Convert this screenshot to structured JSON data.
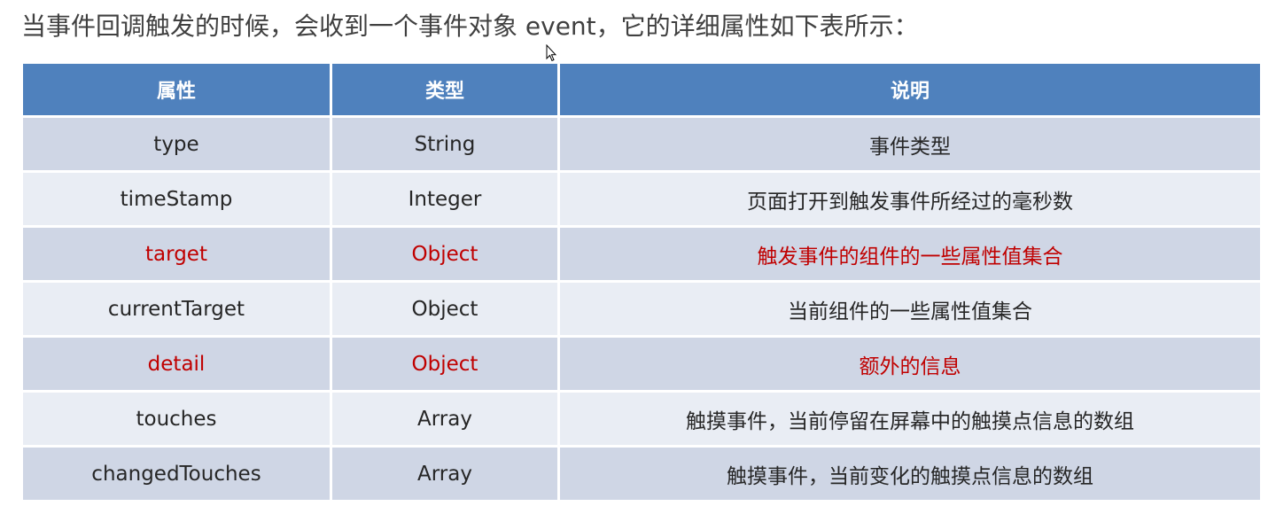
{
  "intro": "当事件回调触发的时候，会收到一个事件对象 event，它的详细属性如下表所示：",
  "colors": {
    "header_bg": "#4f81bd",
    "row_dark": "#cfd6e5",
    "row_light": "#e9edf4",
    "highlight_text": "#c00000"
  },
  "table": {
    "headers": [
      "属性",
      "类型",
      "说明"
    ],
    "rows": [
      {
        "property": "type",
        "type": "String",
        "description": "事件类型",
        "highlighted": false
      },
      {
        "property": "timeStamp",
        "type": "Integer",
        "description": "页面打开到触发事件所经过的毫秒数",
        "highlighted": false
      },
      {
        "property": "target",
        "type": "Object",
        "description": "触发事件的组件的一些属性值集合",
        "highlighted": true
      },
      {
        "property": "currentTarget",
        "type": "Object",
        "description": "当前组件的一些属性值集合",
        "highlighted": false
      },
      {
        "property": "detail",
        "type": "Object",
        "description": "额外的信息",
        "highlighted": true
      },
      {
        "property": "touches",
        "type": "Array",
        "description": "触摸事件，当前停留在屏幕中的触摸点信息的数组",
        "highlighted": false
      },
      {
        "property": "changedTouches",
        "type": "Array",
        "description": "触摸事件，当前变化的触摸点信息的数组",
        "highlighted": false
      }
    ]
  }
}
